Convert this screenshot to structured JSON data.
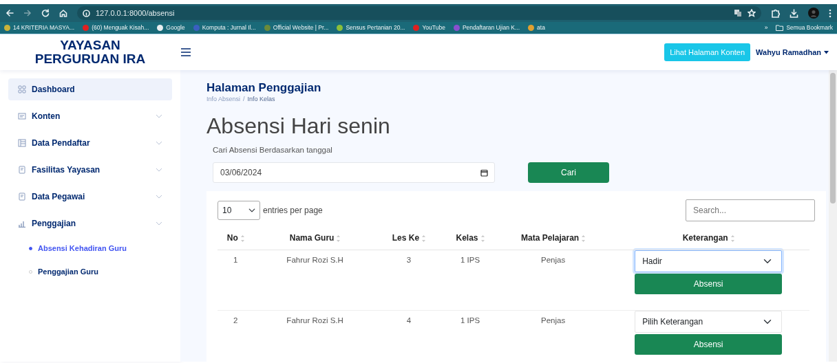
{
  "browser": {
    "url": "127.0.0.1:8000/absensi",
    "bookmarks": [
      {
        "label": "14 KRITERIA MASYA...",
        "color": "#c9b23a"
      },
      {
        "label": "(60) Menguak Kisah...",
        "color": "#e02020"
      },
      {
        "label": "Google",
        "color": "#e8eef0"
      },
      {
        "label": "Komputa : Jurnal Il...",
        "color": "#3a5fc0"
      },
      {
        "label": "Official Website | Pr...",
        "color": "#6a8a3a"
      },
      {
        "label": "Sensus Pertanian 20...",
        "color": "#8bbf3a"
      },
      {
        "label": "YouTube",
        "color": "#e02020"
      },
      {
        "label": "Pendaftaran Ujian K...",
        "color": "#8a4fd0"
      },
      {
        "label": "ata",
        "color": "#e0a030"
      }
    ],
    "overflow": "»",
    "all_bookmarks": "Semua Bookmark"
  },
  "header": {
    "brand": [
      "YAYASAN",
      "PERGURUAN IRA"
    ],
    "content_button": "Lihat Halaman Konten",
    "user": "Wahyu Ramadhan"
  },
  "sidebar": {
    "items": [
      {
        "label": "Dashboard",
        "selected": true,
        "expandable": false
      },
      {
        "label": "Konten",
        "selected": false,
        "expandable": true
      },
      {
        "label": "Data Pendaftar",
        "selected": false,
        "expandable": true
      },
      {
        "label": "Fasilitas Yayasan",
        "selected": false,
        "expandable": true
      },
      {
        "label": "Data Pegawai",
        "selected": false,
        "expandable": true
      },
      {
        "label": "Penggajian",
        "selected": false,
        "expandable": true,
        "children": [
          {
            "label": "Absensi Kehadiran Guru",
            "selected": true
          },
          {
            "label": "Penggajian Guru",
            "selected": false
          }
        ]
      }
    ]
  },
  "page": {
    "title": "Halaman Penggajian",
    "breadcrumb_separator": "/",
    "breadcrumb": [
      {
        "label": "Info Absensi",
        "current": false
      },
      {
        "label": "Info Kelas",
        "current": true
      }
    ],
    "heading": "Absensi Hari senin",
    "date_filter": {
      "label": "Cari Absensi Berdasarkan tanggal",
      "value": "03/06/2024",
      "button": "Cari"
    },
    "table": {
      "entries_value": "10",
      "entries_label": "entries per page",
      "search_placeholder": "Search...",
      "columns": [
        {
          "label": "No",
          "sortable": true
        },
        {
          "label": "Nama Guru",
          "sortable": true
        },
        {
          "label": "Les Ke",
          "sortable": true
        },
        {
          "label": "Kelas",
          "sortable": true
        },
        {
          "label": "Mata Pelajaran",
          "sortable": true
        },
        {
          "label": "Keterangan",
          "sortable": true
        }
      ],
      "rows": [
        {
          "cells": [
            "1",
            "Fahrur Rozi S.H",
            "3",
            "1 IPS",
            "Penjas"
          ],
          "keterangan": "Hadir",
          "focused": true,
          "action": "Absensi"
        },
        {
          "cells": [
            "2",
            "Fahrur Rozi S.H",
            "4",
            "1 IPS",
            "Penjas"
          ],
          "keterangan": "Pilih Keterangan",
          "focused": false,
          "action": "Absensi"
        }
      ]
    }
  }
}
